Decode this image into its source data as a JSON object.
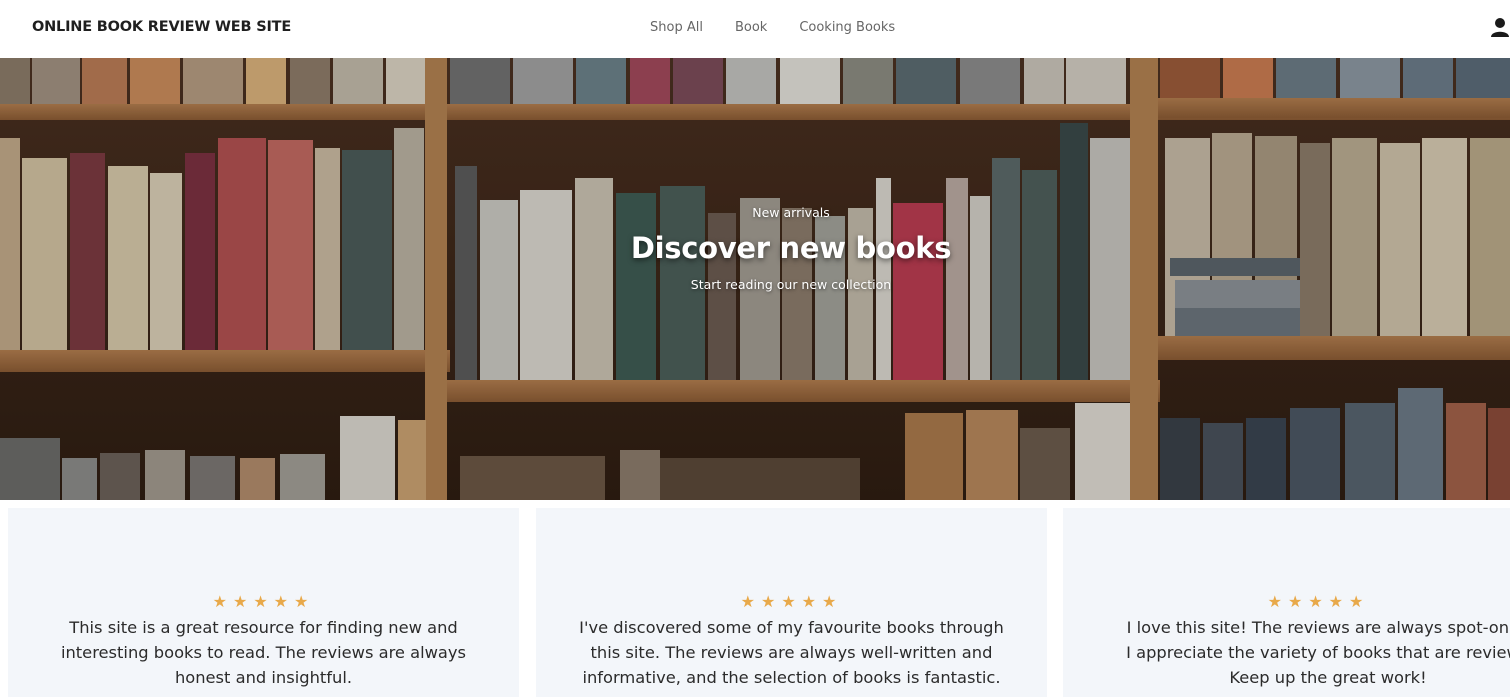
{
  "header": {
    "brand": "ONLINE BOOK REVIEW WEB SITE",
    "nav": [
      {
        "label": "Shop All"
      },
      {
        "label": "Book"
      },
      {
        "label": "Cooking Books"
      }
    ],
    "user_icon": "user-icon"
  },
  "hero": {
    "kicker": "New arrivals",
    "title": "Discover new books",
    "subtitle": "Start reading our new collection",
    "background": "bookshelf-photo"
  },
  "reviews": [
    {
      "rating": 5,
      "stars": "★★★★★",
      "text": "This site is a great resource for finding new and interesting books to read. The reviews are always honest and insightful."
    },
    {
      "rating": 5,
      "stars": "★★★★★",
      "text": "I've discovered some of my favourite books through this site. The reviews are always well-written and informative, and the selection of books is fantastic."
    },
    {
      "rating": 5,
      "stars": "★★★★★",
      "lines": [
        "I love this site! The reviews are always spot-on, a",
        "I appreciate the variety of books that are reviewe",
        "Keep up the great work!"
      ]
    }
  ],
  "colors": {
    "star": "#e8a94a",
    "card_bg": "#f3f6fa",
    "nav_text": "#666666",
    "brand_text": "#1f1f1f"
  }
}
